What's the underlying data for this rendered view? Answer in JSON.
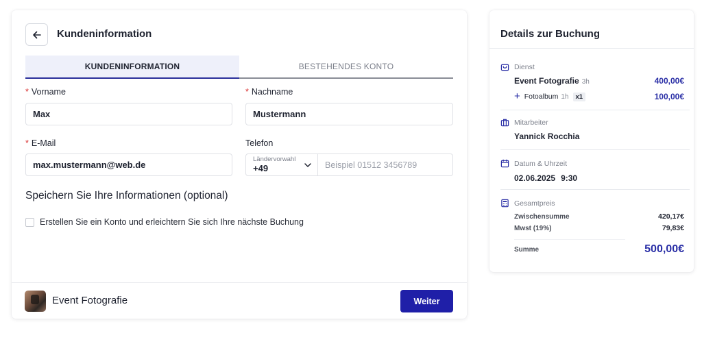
{
  "form": {
    "title": "Kundeninformation",
    "tabs": [
      {
        "label": "KUNDENINFORMATION",
        "active": true
      },
      {
        "label": "BESTEHENDES KONTO",
        "active": false
      }
    ],
    "required_marker": "*",
    "first_name": {
      "label": "Vorname",
      "value": "Max"
    },
    "last_name": {
      "label": "Nachname",
      "value": "Mustermann"
    },
    "email": {
      "label": "E-Mail",
      "value": "max.mustermann@web.de"
    },
    "phone": {
      "label": "Telefon",
      "country_label": "Ländervorwahl",
      "country_code": "+49",
      "placeholder": "Beispiel 01512 3456789"
    },
    "save_section_title": "Speichern Sie Ihre Informationen (optional)",
    "create_account_label": "Erstellen Sie ein Konto und erleichtern Sie sich Ihre nächste Buchung",
    "create_account_checked": false
  },
  "footer": {
    "service_name": "Event Fotografie",
    "next_button": "Weiter"
  },
  "booking": {
    "title": "Details zur Buchung",
    "service": {
      "heading": "Dienst",
      "name": "Event Fotografie",
      "duration": "3h",
      "price": "400,00€",
      "addon": {
        "name": "Fotoalbum",
        "duration": "1h",
        "qty": "x1",
        "price": "100,00€"
      }
    },
    "employee": {
      "heading": "Mitarbeiter",
      "name": "Yannick Rocchia"
    },
    "datetime": {
      "heading": "Datum & Uhrzeit",
      "date": "02.06.2025",
      "time": "9:30"
    },
    "total": {
      "heading": "Gesamtpreis",
      "subtotal_label": "Zwischensumme",
      "subtotal": "420,17€",
      "vat_label": "Mwst (19%)",
      "vat": "79,83€",
      "sum_label": "Summe",
      "sum": "500,00€"
    }
  },
  "colors": {
    "accent": "#1f1fa8",
    "price": "#2a2fa6",
    "required": "#d93030",
    "tab_active_bg": "#eef0fa"
  }
}
